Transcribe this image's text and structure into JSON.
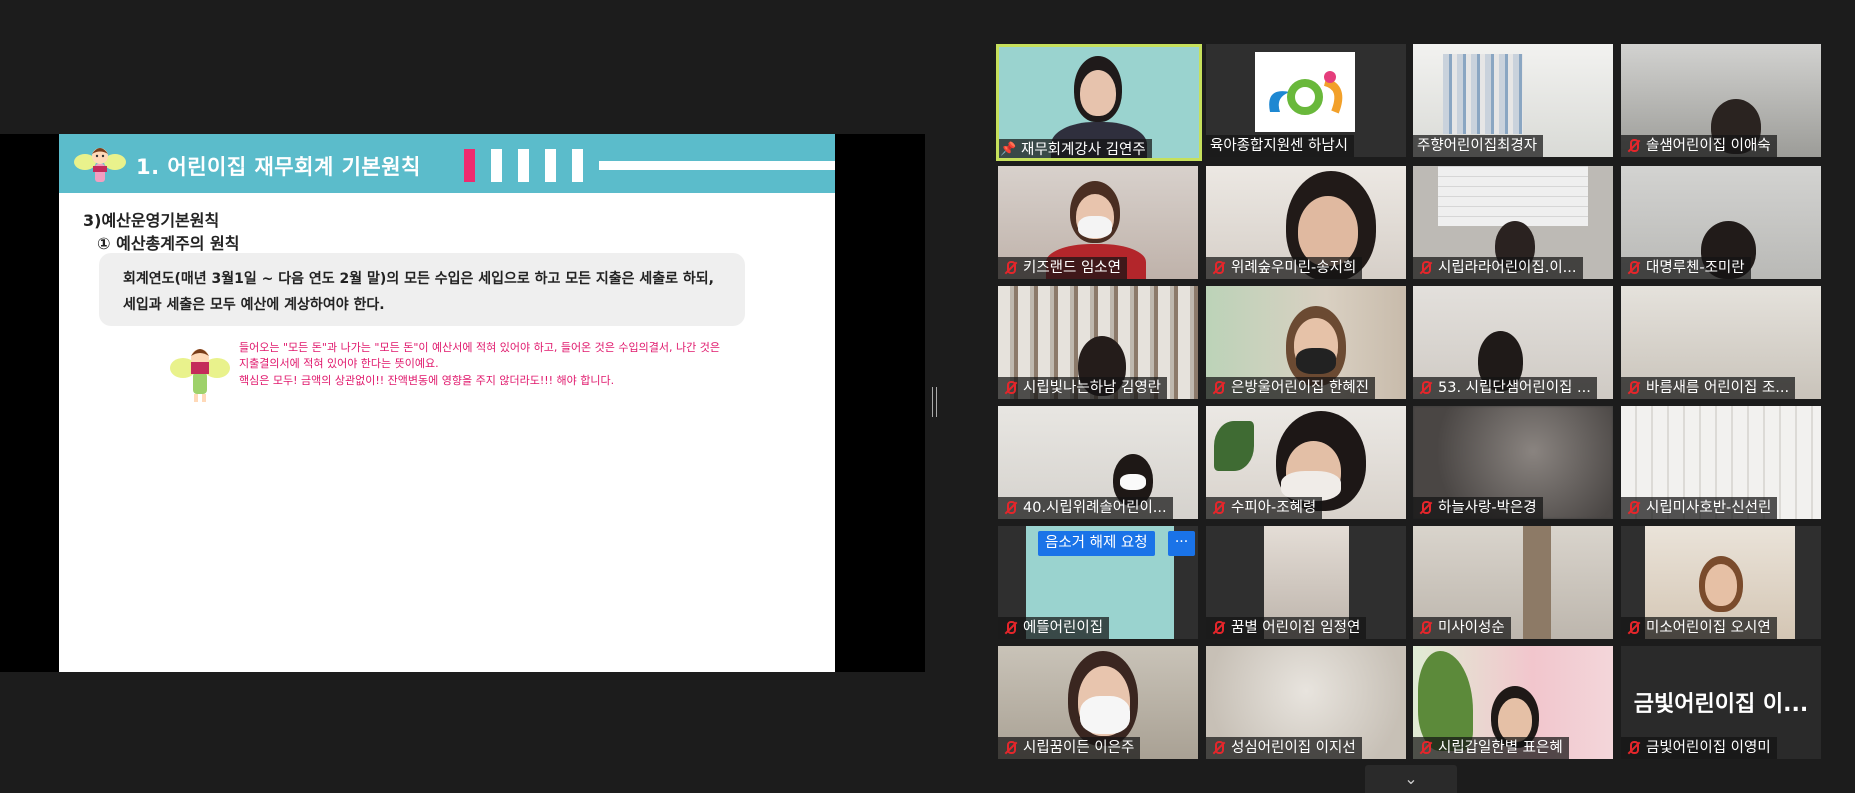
{
  "slide": {
    "title": "1. 어린이집 재무회계 기본원칙",
    "section": "3)예산운영기본원칙",
    "subsection": "① 예산총계주의 원칙",
    "rule_line1": "회계연도(매년 3월1일 ~ 다음 연도 2월 말)의 모든 수입은 세입으로 하고 모든 지출은 세출로 하되,",
    "rule_line2": "세입과 세출은 모두 예산에 계상하여야 한다.",
    "note_line1": "들어오는 \"모든 돈\"과 나가는 \"모든 돈\"이 예산서에  적혀 있어야 하고, 들어온 것은 수입의결서, 나간 것은",
    "note_line2": "지출결의서에 적혀 있어야 한다는 뜻이예요.",
    "note_line3": "핵심은 모두! 금액의 상관없이!! 잔액변동에 영향을 주지 않더라도!!! 해야 합니다."
  },
  "participants": [
    {
      "name": "재무회계강사 김연주",
      "muted": false,
      "pinned": true
    },
    {
      "name": "육아종합지원센 하남시",
      "muted": false,
      "pinned": false
    },
    {
      "name": "주향어린이집최경자",
      "muted": false,
      "pinned": false
    },
    {
      "name": "솔샘어린이집 이애숙",
      "muted": true,
      "pinned": false
    },
    {
      "name": "키즈랜드 임소연",
      "muted": true,
      "pinned": false
    },
    {
      "name": "위례숲우미린-송지희",
      "muted": true,
      "pinned": false
    },
    {
      "name": "시립라라어린이집.이...",
      "muted": true,
      "pinned": false
    },
    {
      "name": "대명루첸-조미란",
      "muted": true,
      "pinned": false
    },
    {
      "name": "시립빛나는하남 김영란",
      "muted": true,
      "pinned": false
    },
    {
      "name": "은방울어린이집 한혜진",
      "muted": true,
      "pinned": false
    },
    {
      "name": "53. 시립단샘어린이집 ...",
      "muted": true,
      "pinned": false
    },
    {
      "name": "바름새름 어린이집 조...",
      "muted": true,
      "pinned": false
    },
    {
      "name": "40.시립위례솔어린이...",
      "muted": true,
      "pinned": false
    },
    {
      "name": "수피아-조혜령",
      "muted": true,
      "pinned": false
    },
    {
      "name": "하늘사랑-박은경",
      "muted": true,
      "pinned": false
    },
    {
      "name": "시립미사호반-신선린",
      "muted": true,
      "pinned": false
    },
    {
      "name": "에뜰어린이집",
      "muted": true,
      "pinned": false
    },
    {
      "name": "꿈별 어린이집 임정연",
      "muted": true,
      "pinned": false
    },
    {
      "name": "미사이성순",
      "muted": true,
      "pinned": false
    },
    {
      "name": "미소어린이집 오시연",
      "muted": true,
      "pinned": false
    },
    {
      "name": "시립꿈이든 이은주",
      "muted": true,
      "pinned": false
    },
    {
      "name": "성심어린이집 이지선",
      "muted": true,
      "pinned": false
    },
    {
      "name": "시립갑일한별 표은혜",
      "muted": true,
      "pinned": false
    },
    {
      "name": "금빛어린이집 이영미",
      "muted": true,
      "pinned": false
    }
  ],
  "big_name": "금빛어린이집 이...",
  "unmute_request": "음소거 해제 요청",
  "more_label": "···",
  "scroll_label": "⌄",
  "colors": {
    "accent": "#1a73e8",
    "active_speaker": "#c6e05c",
    "muted": "#e5262b",
    "slide_header": "#5bbccb",
    "note": "#e0186c"
  }
}
